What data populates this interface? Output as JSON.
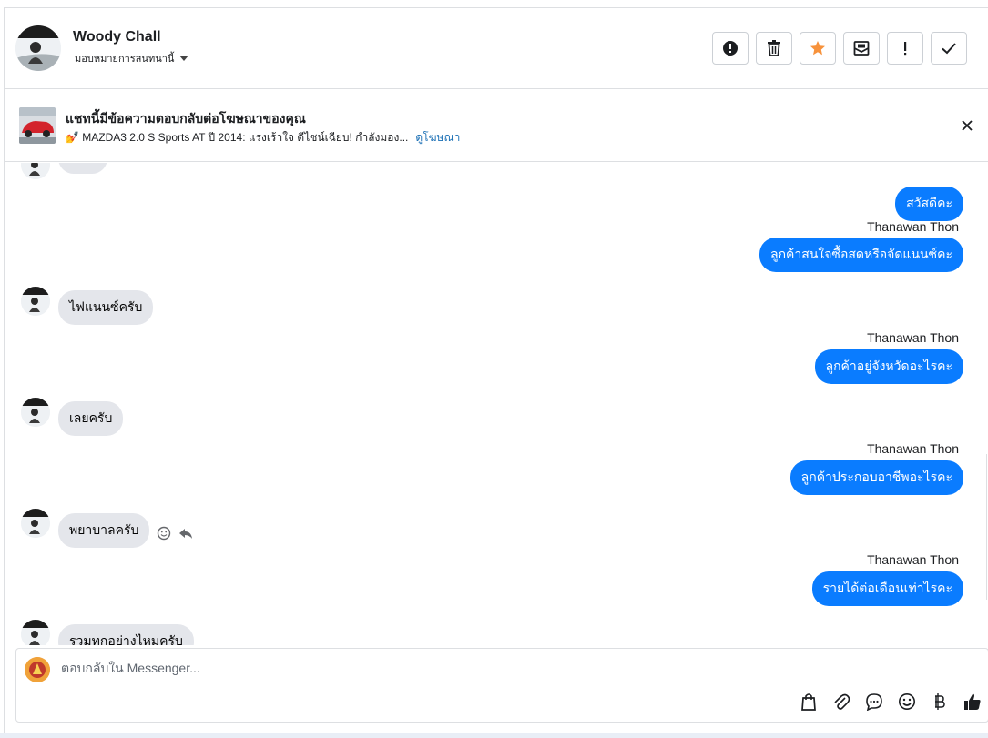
{
  "header": {
    "name": "Woody Chall",
    "assign_label": "มอบหมายการสนทนานี้",
    "actions": [
      {
        "icon": "alert-icon",
        "name": "report-button"
      },
      {
        "icon": "trash-icon",
        "name": "delete-button"
      },
      {
        "icon": "star-icon",
        "name": "star-button",
        "color": "#f7923b"
      },
      {
        "icon": "mark-unread-icon",
        "name": "mark-unread-button"
      },
      {
        "icon": "exclamation-icon",
        "name": "spam-button"
      },
      {
        "icon": "check-icon",
        "name": "done-button"
      }
    ]
  },
  "ad": {
    "title": "แชทนี้มีข้อความตอบกลับต่อโฆษณาของคุณ",
    "subtitle": "💅 MAZDA3 2.0 S Sports AT ปี 2014: แรงเร้าใจ ดีไซน์เฉียบ! กำลังมอง...",
    "link": "ดูโฆษณา"
  },
  "messages": [
    {
      "dir": "out",
      "text": "สวัสดีคะ"
    },
    {
      "dir": "out",
      "sender": "Thanawan Thon",
      "text": "ลูกค้าสนใจซื้อสดหรือจัดแนนซ์คะ"
    },
    {
      "dir": "in",
      "text": "ไฟแนนซ์ครับ"
    },
    {
      "dir": "out",
      "sender": "Thanawan Thon",
      "text": "ลูกค้าอยู่จังหวัดอะไรคะ"
    },
    {
      "dir": "in",
      "text": "เลยครับ"
    },
    {
      "dir": "out",
      "sender": "Thanawan Thon",
      "text": "ลูกค้าประกอบอาชีพอะไรคะ"
    },
    {
      "dir": "in",
      "text": "พยาบาลครับ"
    },
    {
      "dir": "out",
      "sender": "Thanawan Thon",
      "text": "รายได้ต่อเดือนเท่าไรคะ"
    },
    {
      "dir": "in",
      "text": "รวมทกอย่างไหมครับ"
    }
  ],
  "composer": {
    "placeholder": "ตอบกลับใน Messenger...",
    "tools": [
      "shopping-bag-icon",
      "paperclip-icon",
      "saved-reply-icon",
      "emoji-icon",
      "baht-icon",
      "thumbs-up-icon"
    ]
  },
  "colors": {
    "outgoing_bubble": "#0a7cff",
    "incoming_bubble": "#e4e6eb",
    "link": "#1a6fb5"
  }
}
